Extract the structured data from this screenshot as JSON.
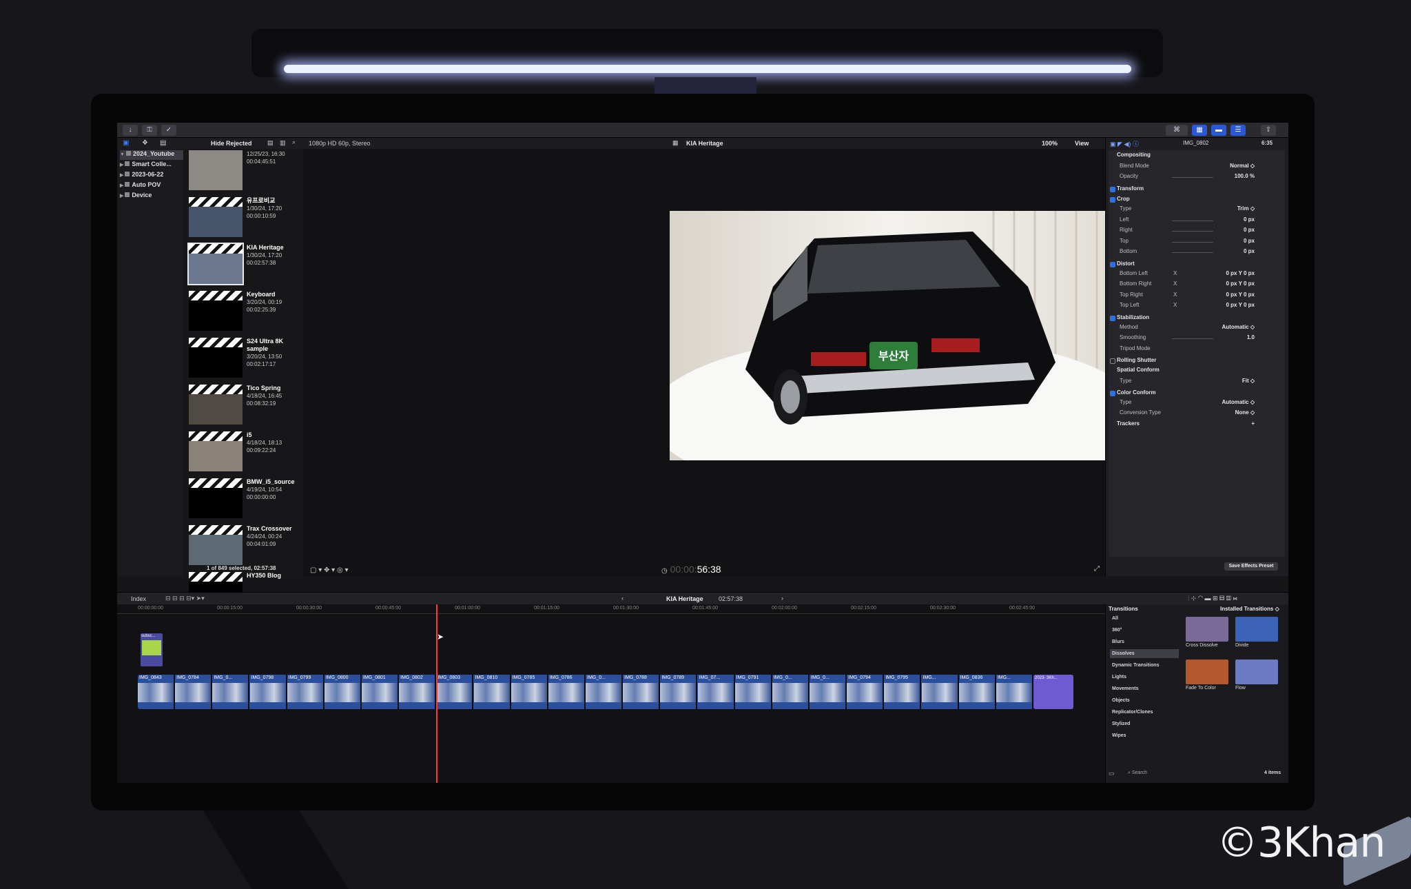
{
  "watermark": "©3Khan",
  "toolbar": {
    "hide_rejected": "Hide Rejected",
    "format": "1080p HD 60p, Stereo",
    "project_title": "KIA Heritage",
    "zoom": "100%",
    "view": "View"
  },
  "libraries": [
    {
      "label": "2024_Youtube",
      "selected": true
    },
    {
      "label": "Smart Colle..."
    },
    {
      "label": "2023-06-22"
    },
    {
      "label": "Auto POV"
    },
    {
      "label": "Device"
    }
  ],
  "clips": [
    {
      "name": "",
      "date": "12/25/23, 16:30",
      "dur": "00:04:45:51",
      "thumb": "#8d8a86",
      "sel": false,
      "clap": false
    },
    {
      "name": "유프로비교",
      "date": "1/30/24, 17:20",
      "dur": "00:00:10:59",
      "thumb": "#46556b",
      "sel": false,
      "clap": true
    },
    {
      "name": "KIA Heritage",
      "date": "1/30/24, 17:20",
      "dur": "00:02:57:38",
      "thumb": "#6b7890",
      "sel": true,
      "clap": true
    },
    {
      "name": "Keyboard",
      "date": "3/20/24, 00:19",
      "dur": "00:02:25:39",
      "thumb": "",
      "sel": false,
      "clap": true
    },
    {
      "name": "S24 Ultra 8K sample",
      "date": "3/20/24, 13:50",
      "dur": "00:02:17:17",
      "thumb": "",
      "sel": false,
      "clap": true
    },
    {
      "name": "Tico Spring",
      "date": "4/18/24, 16:45",
      "dur": "00:08:32:19",
      "thumb": "#4f4a44",
      "sel": false,
      "clap": true
    },
    {
      "name": "i5",
      "date": "4/18/24, 18:13",
      "dur": "00:09:22:24",
      "thumb": "#8a8178",
      "sel": false,
      "clap": true
    },
    {
      "name": "BMW_i5_source",
      "date": "4/19/24, 10:54",
      "dur": "00:00:00:00",
      "thumb": "",
      "sel": false,
      "clap": true
    },
    {
      "name": "Trax Crossover",
      "date": "4/24/24, 00:24",
      "dur": "00:04:01:09",
      "thumb": "#5d6a74",
      "sel": false,
      "clap": true
    },
    {
      "name": "HY350 Blog",
      "date": "",
      "dur": "",
      "thumb": "",
      "sel": false,
      "clap": true
    }
  ],
  "clips_footer": "1 of 849 selected, 02:57:38",
  "timecode": "56:38",
  "timecode_prefix": "00:00:",
  "inspector": {
    "clip_name": "IMG_0802",
    "clip_dur": "6:35",
    "rows": [
      {
        "type": "hdr",
        "label": "Compositing"
      },
      {
        "type": "row",
        "label": "Blend Mode",
        "value": "Normal ◇"
      },
      {
        "type": "row",
        "label": "Opacity",
        "value": "100.0 %",
        "slider": true
      },
      {
        "type": "chk",
        "label": "Transform"
      },
      {
        "type": "chk",
        "label": "Crop"
      },
      {
        "type": "row",
        "label": "Type",
        "value": "Trim ◇"
      },
      {
        "type": "row",
        "label": "Left",
        "value": "0 px",
        "slider": true
      },
      {
        "type": "row",
        "label": "Right",
        "value": "0 px",
        "slider": true
      },
      {
        "type": "row",
        "label": "Top",
        "value": "0 px",
        "slider": true
      },
      {
        "type": "row",
        "label": "Bottom",
        "value": "0 px",
        "slider": true
      },
      {
        "type": "chk",
        "label": "Distort"
      },
      {
        "type": "xy",
        "label": "Bottom Left",
        "value": "0 px    Y    0 px"
      },
      {
        "type": "xy",
        "label": "Bottom Right",
        "value": "0 px    Y    0 px"
      },
      {
        "type": "xy",
        "label": "Top Right",
        "value": "0 px    Y    0 px"
      },
      {
        "type": "xy",
        "label": "Top Left",
        "value": "0 px    Y    0 px"
      },
      {
        "type": "chk",
        "label": "Stabilization"
      },
      {
        "type": "row",
        "label": "Method",
        "value": "Automatic ◇"
      },
      {
        "type": "row",
        "label": "Smoothing",
        "value": "1.0",
        "slider": true
      },
      {
        "type": "row",
        "label": "Tripod Mode",
        "value": ""
      },
      {
        "type": "chkoff",
        "label": "Rolling Shutter"
      },
      {
        "type": "hdr",
        "label": "Spatial Conform"
      },
      {
        "type": "row",
        "label": "Type",
        "value": "Fit ◇"
      },
      {
        "type": "chk",
        "label": "Color Conform"
      },
      {
        "type": "row",
        "label": "Type",
        "value": "Automatic ◇"
      },
      {
        "type": "row",
        "label": "Conversion Type",
        "value": "None ◇"
      },
      {
        "type": "hdr",
        "label": "Trackers",
        "value": "+"
      }
    ],
    "save_preset": "Save Effects Preset"
  },
  "timeline": {
    "index": "Index",
    "project": "KIA Heritage",
    "duration": "02:57:38",
    "ticks": [
      "00:00:00:00",
      "00:00:15:00",
      "00:00:30:00",
      "00:00:45:00",
      "00:01:00:00",
      "00:01:15:00",
      "00:01:30:00",
      "00:01:45:00",
      "00:02:00:00",
      "00:02:15:00",
      "00:02:30:00",
      "00:02:45:00"
    ],
    "segments": [
      "IMG_0843",
      "IMG_0784",
      "IMG_0...",
      "IMG_0798",
      "IMG_0799",
      "IMG_0800",
      "IMG_0801",
      "IMG_0802",
      "IMG_0803",
      "IMG_0810",
      "IMG_0785",
      "IMG_0786",
      "IMG_0...",
      "IMG_0788",
      "IMG_0789",
      "IMG_07...",
      "IMG_0791",
      "IMG_0...",
      "IMG_0...",
      "IMG_0794",
      "IMG_0795",
      "IMG...",
      "IMG_0836",
      "IMG..."
    ],
    "connected": "subsc...",
    "end_clip": "2023- 3Kh..."
  },
  "transitions": {
    "title": "Transitions",
    "installed": "Installed Transitions ◇",
    "categories": [
      "All",
      "360°",
      "Blurs",
      "Dissolves",
      "Dynamic Transitions",
      "Lights",
      "Movements",
      "Objects",
      "Replicator/Clones",
      "Stylized",
      "Wipes"
    ],
    "selected": "Dissolves",
    "items": [
      {
        "label": "Cross Dissolve",
        "color": "#7a6a9a"
      },
      {
        "label": "Divide",
        "color": "#3b63b8"
      },
      {
        "label": "Fade To Color",
        "color": "#b3572e"
      },
      {
        "label": "Flow",
        "color": "#6b7bc6"
      }
    ],
    "search": "Search",
    "count": "4 items"
  }
}
